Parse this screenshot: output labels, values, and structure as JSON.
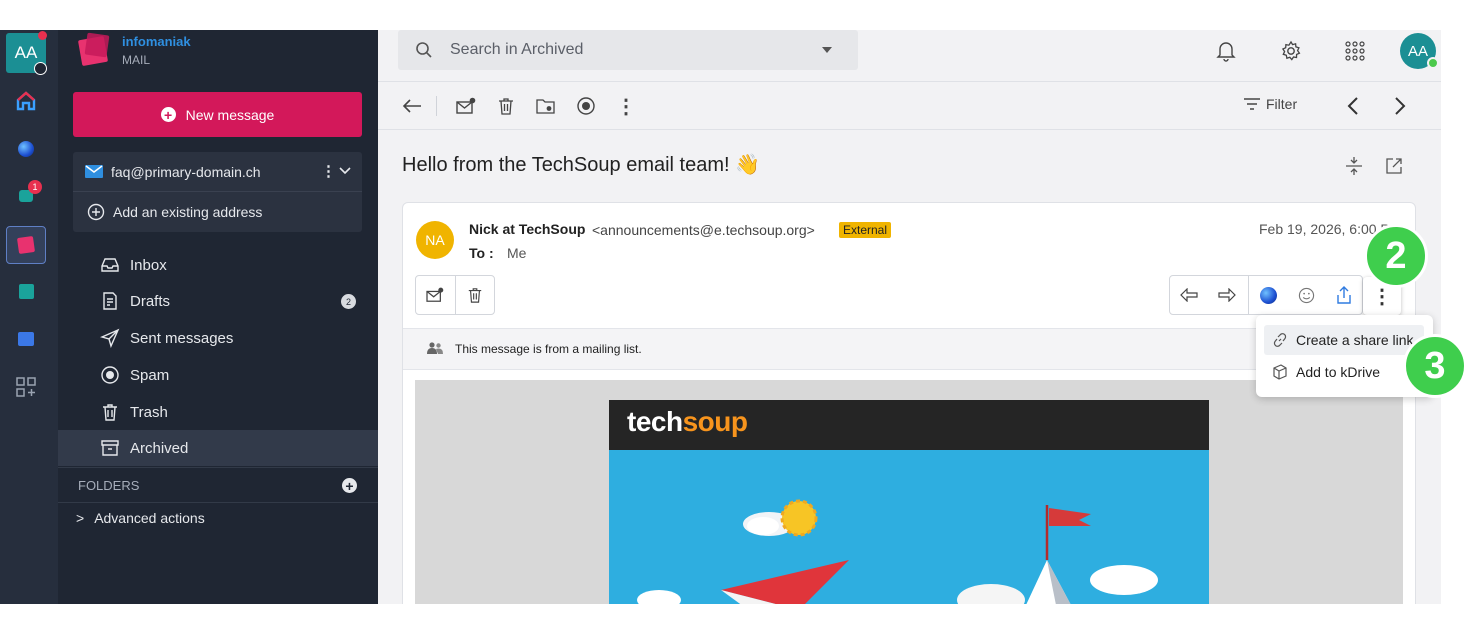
{
  "rail": {
    "avatar_initials": "AA",
    "drafts_badge": "1",
    "apps": [
      "home-icon",
      "ai-orb-icon",
      "kchat-icon",
      "mail-icon",
      "calendar-icon",
      "kdrive-icon",
      "more-apps-icon"
    ]
  },
  "sidebar": {
    "brand_name": "infomaniak",
    "brand_sub": "MAIL",
    "new_message_label": "New message",
    "account_email": "faq@primary-domain.ch",
    "add_address_label": "Add an existing address",
    "folders": [
      {
        "label": "Inbox",
        "icon": "inbox-icon"
      },
      {
        "label": "Drafts",
        "icon": "drafts-icon",
        "count": "2"
      },
      {
        "label": "Sent messages",
        "icon": "send-icon"
      },
      {
        "label": "Spam",
        "icon": "spam-icon"
      },
      {
        "label": "Trash",
        "icon": "trash-icon"
      },
      {
        "label": "Archived",
        "icon": "archive-icon",
        "active": true
      }
    ],
    "folders_header": "FOLDERS",
    "advanced_actions": "Advanced actions"
  },
  "topbar": {
    "search_placeholder": "Search in Archived",
    "avatar_initials": "AA"
  },
  "toolbar": {
    "filter_label": "Filter"
  },
  "message": {
    "subject": "Hello from the TechSoup email team! 👋",
    "sender_initials": "NA",
    "sender_name": "Nick at TechSoup",
    "sender_address": "<announcements@e.techsoup.org>",
    "external_badge": "External",
    "to_label": "To :",
    "to_value": "Me",
    "date": "Feb 19, 2026, 6:00 PM",
    "mailing_list_note": "This message is from a mailing list."
  },
  "email_body": {
    "logo_tech": "tech",
    "logo_s": "s",
    "logo_o": "o",
    "logo_up": "up"
  },
  "more_menu": {
    "items": [
      {
        "label": "Create a share link",
        "icon": "link-icon"
      },
      {
        "label": "Add to kDrive",
        "icon": "kdrive-icon"
      }
    ]
  },
  "steps": {
    "step_a": "2",
    "step_b": "3"
  },
  "colors": {
    "accent": "#d3185a",
    "sidebar_bg": "#1f2633",
    "rail_bg": "#262e3d",
    "step_badge": "#3fce4d",
    "external_badge": "#f0b400"
  }
}
